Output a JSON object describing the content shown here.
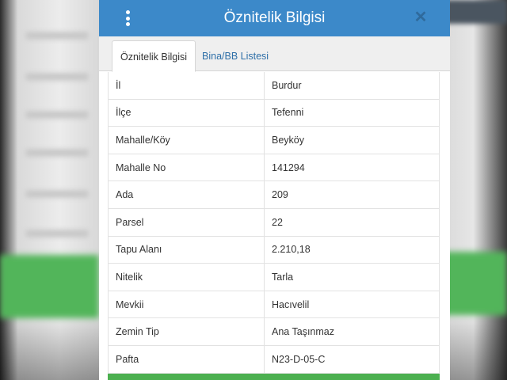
{
  "dialog": {
    "title": "Öznitelik Bilgisi",
    "menu_icon": "more-vertical-icon",
    "close_icon": "close-icon",
    "close_glyph": "✕"
  },
  "tabs": [
    {
      "label": "Öznitelik Bilgisi",
      "active": true
    },
    {
      "label": "Bina/BB Listesi",
      "active": false
    }
  ],
  "attributes": [
    {
      "key": "İl",
      "value": "Burdur"
    },
    {
      "key": "İlçe",
      "value": "Tefenni"
    },
    {
      "key": "Mahalle/Köy",
      "value": "Beyköy"
    },
    {
      "key": "Mahalle No",
      "value": "141294"
    },
    {
      "key": "Ada",
      "value": "209"
    },
    {
      "key": "Parsel",
      "value": "22"
    },
    {
      "key": "Tapu Alanı",
      "value": "2.210,18"
    },
    {
      "key": "Nitelik",
      "value": "Tarla"
    },
    {
      "key": "Mevkii",
      "value": "Hacıvelil"
    },
    {
      "key": "Zemin Tip",
      "value": "Ana Taşınmaz"
    },
    {
      "key": "Pafta",
      "value": "N23-D-05-C"
    }
  ],
  "colors": {
    "header": "#3c89c9",
    "tab_link": "#2e6fa8",
    "action_bar": "#4cb050"
  }
}
